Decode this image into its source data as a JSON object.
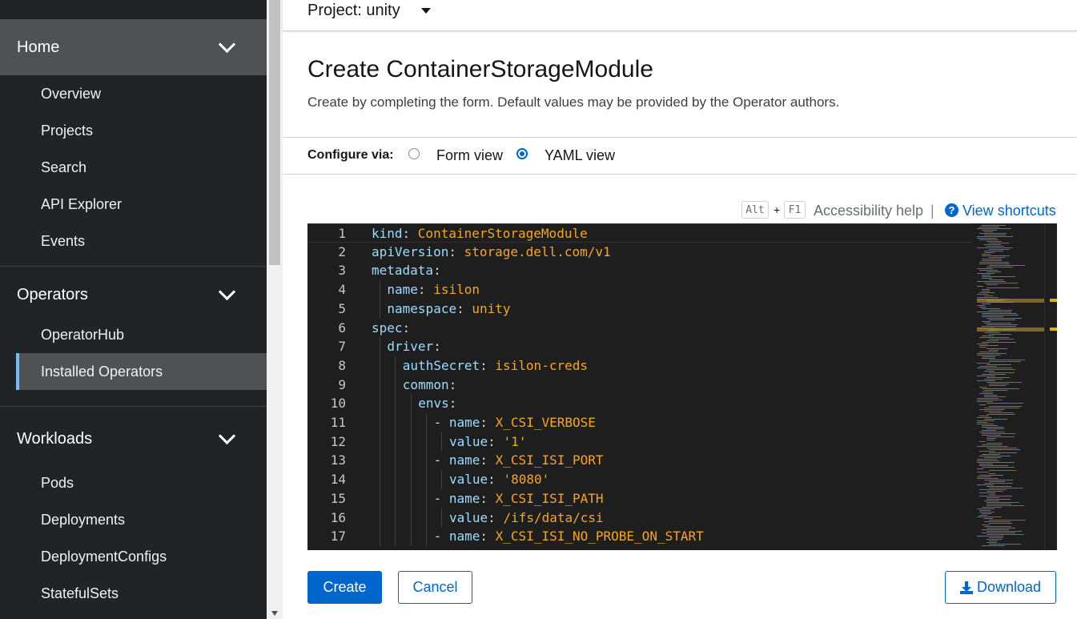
{
  "sidebar": {
    "groups": [
      {
        "label": "Home",
        "items": [
          "Overview",
          "Projects",
          "Search",
          "API Explorer",
          "Events"
        ]
      },
      {
        "label": "Operators",
        "items": [
          "OperatorHub",
          "Installed Operators"
        ]
      },
      {
        "label": "Workloads",
        "items": [
          "Pods",
          "Deployments",
          "DeploymentConfigs",
          "StatefulSets"
        ]
      }
    ],
    "current_item": "Installed Operators"
  },
  "project_selector": {
    "label": "Project: unity"
  },
  "page": {
    "title": "Create ContainerStorageModule",
    "description": "Create by completing the form. Default values may be provided by the Operator authors."
  },
  "configure": {
    "label": "Configure via:",
    "options": [
      "Form view",
      "YAML view"
    ],
    "selected": "YAML view"
  },
  "accessibility": {
    "key1": "Alt",
    "plus": "+",
    "key2": "F1",
    "help_label": "Accessibility help",
    "separator": "|",
    "shortcuts_label": "View shortcuts"
  },
  "editor": {
    "lines": [
      {
        "n": "1",
        "indent": 0,
        "key": "kind",
        "value": "ContainerStorageModule"
      },
      {
        "n": "2",
        "indent": 0,
        "key": "apiVersion",
        "value": "storage.dell.com/v1"
      },
      {
        "n": "3",
        "indent": 0,
        "key": "metadata",
        "value": ""
      },
      {
        "n": "4",
        "indent": 1,
        "key": "name",
        "value": "isilon"
      },
      {
        "n": "5",
        "indent": 1,
        "key": "namespace",
        "value": "unity"
      },
      {
        "n": "6",
        "indent": 0,
        "key": "spec",
        "value": ""
      },
      {
        "n": "7",
        "indent": 1,
        "key": "driver",
        "value": ""
      },
      {
        "n": "8",
        "indent": 2,
        "key": "authSecret",
        "value": "isilon-creds"
      },
      {
        "n": "9",
        "indent": 2,
        "key": "common",
        "value": ""
      },
      {
        "n": "10",
        "indent": 3,
        "key": "envs",
        "value": ""
      },
      {
        "n": "11",
        "indent": 4,
        "dash": true,
        "key": "name",
        "value": "X_CSI_VERBOSE"
      },
      {
        "n": "12",
        "indent": 5,
        "key": "value",
        "value": "'1'"
      },
      {
        "n": "13",
        "indent": 4,
        "dash": true,
        "key": "name",
        "value": "X_CSI_ISI_PORT"
      },
      {
        "n": "14",
        "indent": 5,
        "key": "value",
        "value": "'8080'"
      },
      {
        "n": "15",
        "indent": 4,
        "dash": true,
        "key": "name",
        "value": "X_CSI_ISI_PATH"
      },
      {
        "n": "16",
        "indent": 5,
        "key": "value",
        "value": "/ifs/data/csi"
      },
      {
        "n": "17",
        "indent": 4,
        "dash": true,
        "key": "name",
        "value": "X_CSI_ISI_NO_PROBE_ON_START"
      }
    ]
  },
  "actions": {
    "create_label": "Create",
    "cancel_label": "Cancel",
    "download_label": "Download"
  },
  "colors": {
    "accent": "#0066cc",
    "sidebar_bg": "#212427",
    "editor_bg": "#1e1e1e",
    "yaml_key": "#9cdcfe",
    "yaml_value": "#f5a623"
  }
}
